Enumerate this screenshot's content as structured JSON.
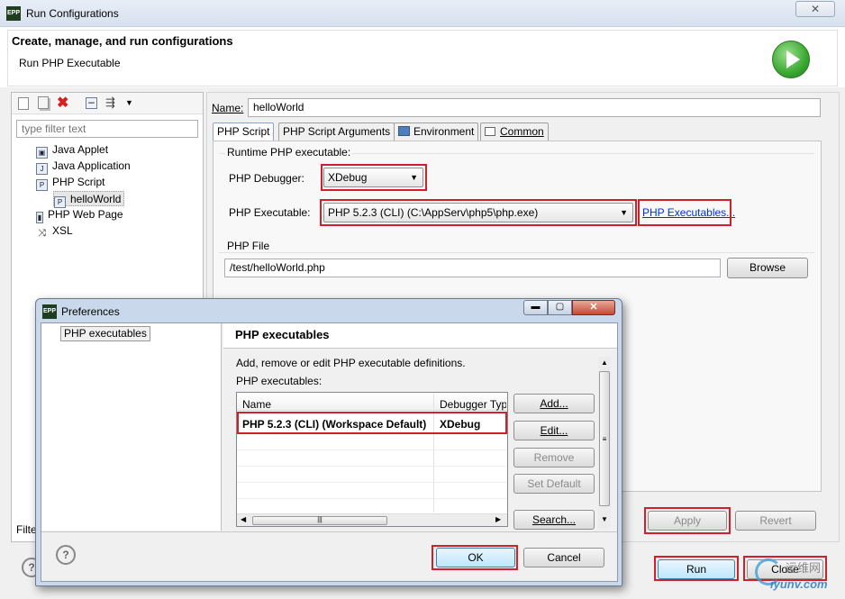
{
  "window": {
    "title": "Run Configurations",
    "logo": "EPP",
    "close_label": "✕"
  },
  "header": {
    "title": "Create, manage, and run configurations",
    "subtitle": "Run PHP Executable"
  },
  "left": {
    "filter_placeholder": "type filter text",
    "items": [
      {
        "label": "Java Applet",
        "icon": "java-applet-icon"
      },
      {
        "label": "Java Application",
        "icon": "java-application-icon"
      },
      {
        "label": "PHP Script",
        "icon": "php-script-icon"
      },
      {
        "label": "helloWorld",
        "icon": "php-file-icon"
      },
      {
        "label": "PHP Web Page",
        "icon": "php-web-page-icon"
      },
      {
        "label": "XSL",
        "icon": "xsl-icon"
      }
    ],
    "footer_label": "Filte"
  },
  "config": {
    "name_label": "Name:",
    "name_value": "helloWorld",
    "tabs": [
      "PHP Script",
      "PHP Script Arguments",
      "Environment",
      "Common"
    ],
    "runtime_label": "Runtime PHP executable:",
    "debugger_label": "PHP Debugger:",
    "debugger_value": "XDebug",
    "executable_label": "PHP Executable:",
    "executable_value": "PHP 5.2.3 (CLI) (C:\\AppServ\\php5\\php.exe)",
    "executables_link": "PHP Executables...",
    "file_label": "PHP File",
    "file_value": "/test/helloWorld.php",
    "browse_label": "Browse",
    "apply_label": "Apply",
    "revert_label": "Revert",
    "run_label": "Run",
    "close_label": "Close"
  },
  "preferences": {
    "title": "Preferences",
    "logo": "EPP",
    "tree_item": "PHP executables",
    "page_title": "PHP executables",
    "description": "Add, remove or edit PHP executable definitions.",
    "list_label": "PHP executables:",
    "columns": [
      "Name",
      "Debugger Typ"
    ],
    "rows": [
      {
        "name": "PHP 5.2.3 (CLI) (Workspace Default)",
        "debugger": "XDebug"
      }
    ],
    "buttons": {
      "add": "Add...",
      "edit": "Edit...",
      "remove": "Remove",
      "set_default": "Set Default",
      "search": "Search..."
    },
    "ok_label": "OK",
    "cancel_label": "Cancel",
    "help_label": "?"
  },
  "watermark": {
    "text1": "运维网",
    "text2": "iyunv.com"
  },
  "colors": {
    "highlight": "#d0202a",
    "link": "#0033cc",
    "run_icon": "#3aa832"
  }
}
